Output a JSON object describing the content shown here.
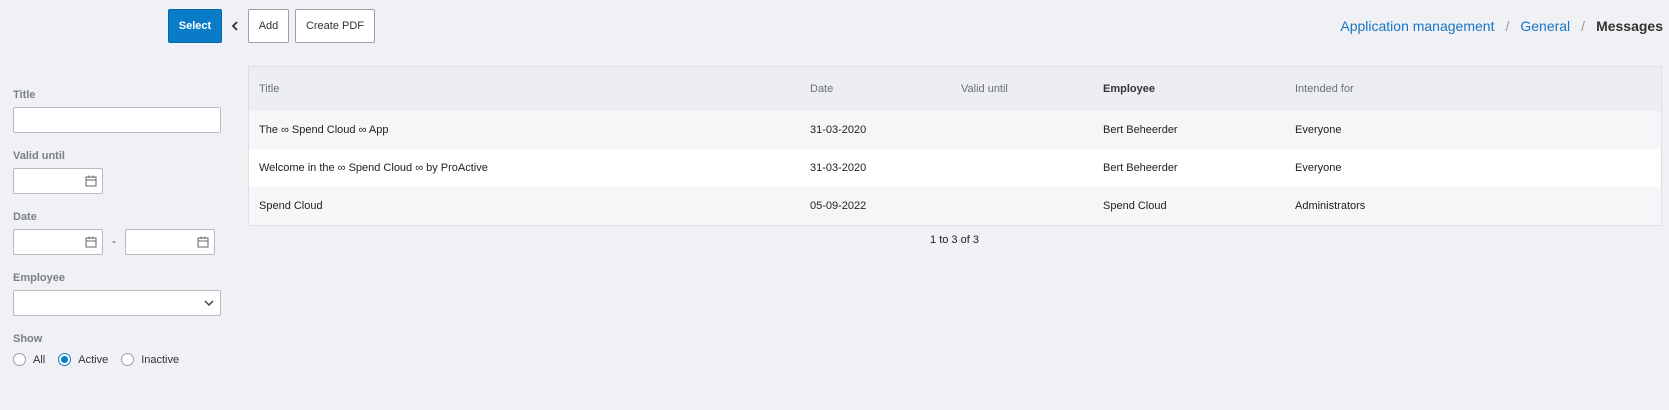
{
  "toolbar": {
    "select_label": "Select",
    "add_label": "Add",
    "create_pdf_label": "Create PDF"
  },
  "breadcrumb": {
    "items": [
      "Application management",
      "General"
    ],
    "separator": "/",
    "current": "Messages"
  },
  "filters": {
    "title_label": "Title",
    "title_value": "",
    "valid_until_label": "Valid until",
    "valid_until_value": "",
    "date_label": "Date",
    "date_from": "",
    "date_separator": "-",
    "date_to": "",
    "employee_label": "Employee",
    "employee_value": "",
    "show_label": "Show",
    "show_options": [
      "All",
      "Active",
      "Inactive"
    ],
    "show_selected": "Active"
  },
  "table": {
    "columns": [
      "Title",
      "Date",
      "Valid until",
      "Employee",
      "Intended for"
    ],
    "rows": [
      [
        "The ∞ Spend Cloud ∞ App",
        "31-03-2020",
        "",
        "Bert Beheerder",
        "Everyone"
      ],
      [
        "Welcome in the ∞ Spend Cloud ∞ by ProActive",
        "31-03-2020",
        "",
        "Bert Beheerder",
        "Everyone"
      ],
      [
        "Spend Cloud",
        "05-09-2022",
        "",
        "Spend Cloud",
        "Administrators"
      ]
    ],
    "pagination": "1 to 3 of 3"
  },
  "colors": {
    "accent": "#0a7bc7",
    "link": "#1a75c2",
    "background": "#f0f1f5"
  },
  "icons": {
    "back": "chevron-left-icon",
    "calendar": "calendar-icon",
    "dropdown": "chevron-down-icon"
  }
}
